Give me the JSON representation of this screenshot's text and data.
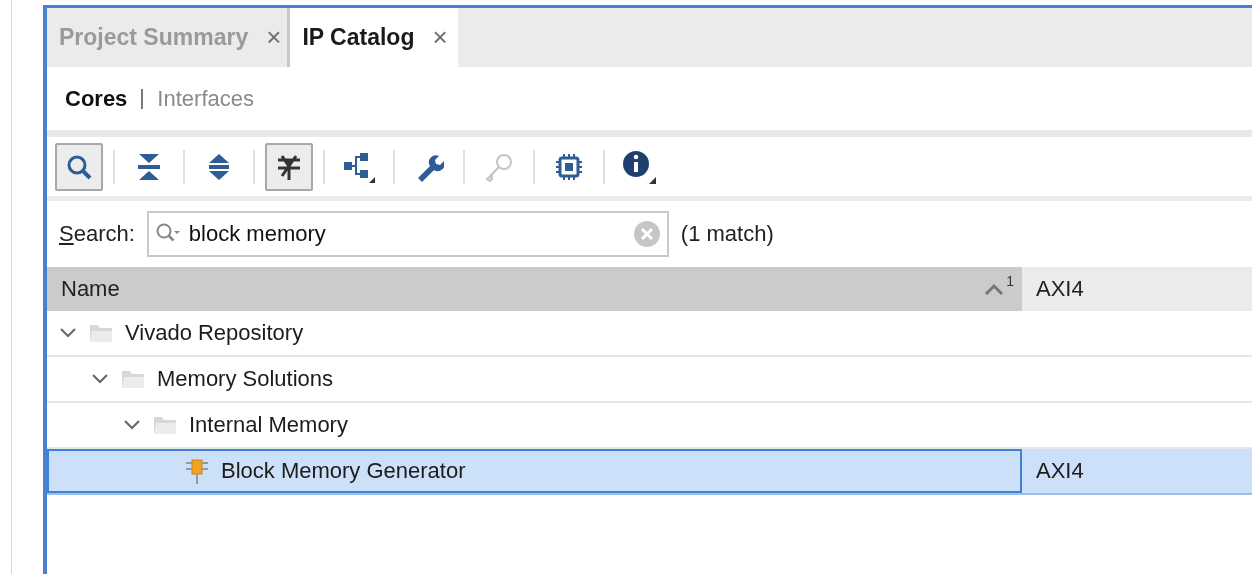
{
  "tabs": [
    {
      "label": "Project Summary",
      "selected": false,
      "close": "×"
    },
    {
      "label": "IP Catalog",
      "selected": true,
      "close": "×"
    }
  ],
  "views": [
    {
      "label": "Cores",
      "selected": true
    },
    {
      "label": "Interfaces",
      "selected": false
    }
  ],
  "toolbar": [
    {
      "kind": "search",
      "pressed": true,
      "disabled": false
    },
    {
      "kind": "collapse",
      "pressed": false,
      "disabled": false
    },
    {
      "kind": "expand",
      "pressed": false,
      "disabled": false
    },
    {
      "kind": "filter",
      "pressed": true,
      "disabled": false
    },
    {
      "kind": "hierarchy",
      "pressed": false,
      "disabled": false
    },
    {
      "kind": "wrench",
      "pressed": false,
      "disabled": false
    },
    {
      "kind": "key",
      "pressed": false,
      "disabled": true
    },
    {
      "kind": "chip",
      "pressed": false,
      "disabled": false
    },
    {
      "kind": "info",
      "pressed": false,
      "disabled": false
    }
  ],
  "search": {
    "label": "Search:",
    "value": "block memory",
    "result": "(1 match)"
  },
  "table": {
    "columns": [
      {
        "label": "Name",
        "sort_rank": "1"
      },
      {
        "label": "AXI4"
      }
    ],
    "rows": [
      {
        "kind": "folder",
        "name": "Vivado Repository",
        "expanded": true,
        "selected": false,
        "children": [
          {
            "kind": "folder",
            "name": "Memory Solutions",
            "expanded": true,
            "selected": false,
            "children": [
              {
                "kind": "folder",
                "name": "Internal Memory",
                "expanded": true,
                "selected": false,
                "children": [
                  {
                    "kind": "ip",
                    "name": "Block Memory Generator",
                    "axi4": "AXI4",
                    "selected": true
                  }
                ]
              }
            ]
          }
        ]
      }
    ]
  }
}
